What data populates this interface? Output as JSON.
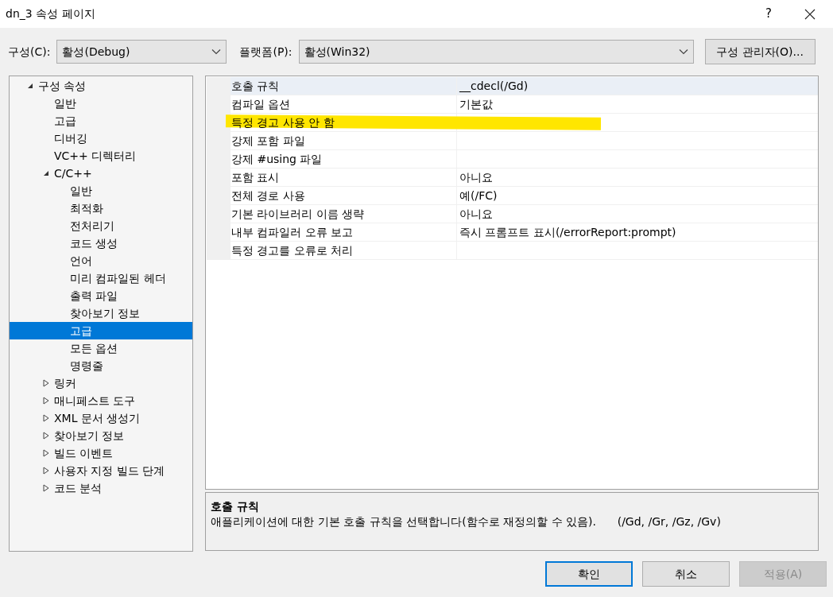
{
  "window": {
    "title": "dn_3 속성 페이지",
    "help": "?"
  },
  "toolbar": {
    "configuration": {
      "label": "구성(C):",
      "value": "활성(Debug)"
    },
    "platform": {
      "label": "플랫폼(P):",
      "value": "활성(Win32)"
    },
    "manager_button": "구성 관리자(O)..."
  },
  "tree": [
    {
      "label": "구성 속성",
      "expanded": true,
      "selected": false,
      "children": [
        {
          "label": "일반",
          "selected": false
        },
        {
          "label": "고급",
          "selected": false
        },
        {
          "label": "디버깅",
          "selected": false
        },
        {
          "label": "VC++ 디렉터리",
          "selected": false
        },
        {
          "label": "C/C++",
          "expanded": true,
          "selected": false,
          "children": [
            {
              "label": "일반",
              "selected": false
            },
            {
              "label": "최적화",
              "selected": false
            },
            {
              "label": "전처리기",
              "selected": false
            },
            {
              "label": "코드 생성",
              "selected": false
            },
            {
              "label": "언어",
              "selected": false
            },
            {
              "label": "미리 컴파일된 헤더",
              "selected": false
            },
            {
              "label": "출력 파일",
              "selected": false
            },
            {
              "label": "찾아보기 정보",
              "selected": false
            },
            {
              "label": "고급",
              "selected": true
            },
            {
              "label": "모든 옵션",
              "selected": false
            },
            {
              "label": "명령줄",
              "selected": false
            }
          ]
        },
        {
          "label": "링커",
          "expanded": false,
          "selected": false
        },
        {
          "label": "매니페스트 도구",
          "expanded": false,
          "selected": false
        },
        {
          "label": "XML 문서 생성기",
          "expanded": false,
          "selected": false
        },
        {
          "label": "찾아보기 정보",
          "expanded": false,
          "selected": false
        },
        {
          "label": "빌드 이벤트",
          "expanded": false,
          "selected": false
        },
        {
          "label": "사용자 지정 빌드 단계",
          "expanded": false,
          "selected": false
        },
        {
          "label": "코드 분석",
          "expanded": false,
          "selected": false
        }
      ]
    }
  ],
  "properties": [
    {
      "name": "호출 규칙",
      "value": "__cdecl(/Gd)",
      "selected": true,
      "highlighted": false
    },
    {
      "name": "컴파일 옵션",
      "value": "기본값",
      "selected": false,
      "highlighted": false
    },
    {
      "name": "특정 경고 사용 안 함",
      "selected": false,
      "highlighted": true
    },
    {
      "name": "강제 포함 파일",
      "selected": false,
      "highlighted": false
    },
    {
      "name": "강제 #using 파일",
      "selected": false,
      "highlighted": false
    },
    {
      "name": "포함 표시",
      "value": "아니요",
      "selected": false,
      "highlighted": false
    },
    {
      "name": "전체 경로 사용",
      "value": "예(/FC)",
      "selected": false,
      "highlighted": false
    },
    {
      "name": "기본 라이브러리 이름 생략",
      "value": "아니요",
      "selected": false,
      "highlighted": false
    },
    {
      "name": "내부 컴파일러 오류 보고",
      "value": "즉시 프롬프트 표시(/errorReport:prompt)",
      "selected": false,
      "highlighted": false
    },
    {
      "name": "특정 경고를 오류로 처리",
      "selected": false,
      "highlighted": false
    }
  ],
  "description": {
    "title": "호출 규칙",
    "text": "애플리케이션에 대한 기본 호출 규칙을 선택합니다(함수로 재정의할 수 있음).      (/Gd, /Gr, /Gz, /Gv)"
  },
  "buttons": [
    {
      "label": "확인",
      "default": true,
      "disabled": false
    },
    {
      "label": "취소",
      "default": false,
      "disabled": false
    },
    {
      "label": "적용(A)",
      "default": false,
      "disabled": true
    }
  ]
}
